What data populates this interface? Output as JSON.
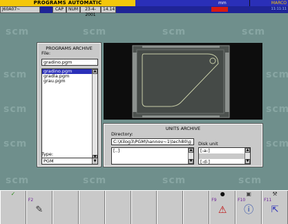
{
  "title_bar": {
    "title": "PROGRAMS AUTOMATIC",
    "mode": "mm",
    "user": "MARCO"
  },
  "info_bar": {
    "machine_code": "J60A07~",
    "cap": "CAP",
    "num": "NUM",
    "date": "23-4-2001",
    "time": "14.14",
    "clock": "11:11:11"
  },
  "programs_archive": {
    "title": "PROGRAMS ARCHIVE",
    "file_label": "File:",
    "file_value": "gradino.pgm",
    "files": [
      "gradino.pgm",
      "gradla.pgm",
      "grau.pgm"
    ],
    "selected_index": 0,
    "type_label": "Type:",
    "type_value": "PGM"
  },
  "units_archive": {
    "title": "UNITS ARCHIVE",
    "directory_label": "Directory:",
    "directory_value": "C:\\Xilog3\\PGM\\hannov~1\\tech80\\g",
    "directory_items": [
      "[..]"
    ],
    "disk_label": "Disk unit",
    "disks": [
      "[-a-]",
      "",
      "[-d-]"
    ]
  },
  "function_keys": [
    {
      "label": "",
      "top_icon": "check-icon",
      "big_icon": ""
    },
    {
      "label": "F2",
      "top_icon": "",
      "big_icon": "pencil-icon"
    },
    {
      "label": "",
      "top_icon": "",
      "big_icon": ""
    },
    {
      "label": "",
      "top_icon": "",
      "big_icon": ""
    },
    {
      "label": "",
      "top_icon": "",
      "big_icon": ""
    },
    {
      "label": "",
      "top_icon": "",
      "big_icon": ""
    },
    {
      "label": "",
      "top_icon": "",
      "big_icon": ""
    },
    {
      "label": "",
      "top_icon": "",
      "big_icon": ""
    },
    {
      "label": "F9",
      "top_icon": "dot-icon",
      "big_icon": "warning-icon"
    },
    {
      "label": "F10",
      "top_icon": "disk-icon",
      "big_icon": "info-icon"
    },
    {
      "label": "F11",
      "top_icon": "spanner-icon",
      "big_icon": "exit-icon"
    }
  ],
  "watermark_text": "scm",
  "colors": {
    "title_yellow": "#f4c70a",
    "status_blue": "#2a2fb8",
    "selection_blue": "#2a2fb8",
    "alarm_red": "#d81a12",
    "panel_gray": "#c9c9c9",
    "background_teal": "#6f8f8c"
  }
}
